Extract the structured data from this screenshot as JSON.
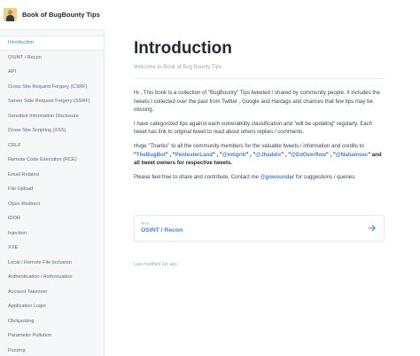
{
  "site": {
    "title": "Book of BugBounty Tips"
  },
  "sidebar": {
    "items": [
      {
        "label": "Introduction",
        "active": true
      },
      {
        "label": "OSINT / Recon"
      },
      {
        "label": "API"
      },
      {
        "label": "Cross Site Request Forgery (CSRF)"
      },
      {
        "label": "Server Side Request Forgery (SSRF)"
      },
      {
        "label": "Sensitive Information Disclosure"
      },
      {
        "label": "Cross Site Scripting (XSS)"
      },
      {
        "label": "CRLF"
      },
      {
        "label": "Remote Code Execution (RCE)"
      },
      {
        "label": "Email Related"
      },
      {
        "label": "File Upload"
      },
      {
        "label": "Open Redirect"
      },
      {
        "label": "IDOR"
      },
      {
        "label": "Injection"
      },
      {
        "label": "XXE"
      },
      {
        "label": "Local / Remote File Inclusion"
      },
      {
        "label": "Authentication / Authorization"
      },
      {
        "label": "Account Takeover"
      },
      {
        "label": "Application Login"
      },
      {
        "label": "Clickjacking"
      },
      {
        "label": "Parameter Pollution"
      },
      {
        "label": "Fuzzing"
      }
    ]
  },
  "page": {
    "title": "Introduction",
    "description": "Welcome to Book of Bug Bounty Tips",
    "paragraphs": {
      "p1": "Hi , This book is a collection of \"BugBounty\" Tips tweeted / shared by community people. It includes the tweets I collected over the past from Twitter , Google and Hastags and chances that few tips may be missing.",
      "p2": "I have categorized tips against each vulnerability classification and \"will be updating\" regularly. Each tweet has link to original tweet to read about others replies / comments.",
      "p3": {
        "intro": "Huge \"Thanks\" to all the community members for the valuable tweets / information and credits to ",
        "q_open": "\"",
        "sep1": "\" , \"",
        "sep2": "\" , \"",
        "sep3": "\" , \"",
        "sep4": "\" , \"",
        "sep5": "\" , \"",
        "q_close": "\"",
        "outro": " and all tweet owners for respective tweets.",
        "mentions": [
          "TheBugBot",
          "PentesterLand",
          "@intigriti",
          "@Jhaddix",
          "@EdOverflow",
          "@Nahamsec"
        ]
      },
      "p4": {
        "before": "Please feel free to share and contribute. Contact me ",
        "mention": "@gowsundar",
        "after": " for suggestions / queries."
      }
    },
    "next": {
      "caption": "Next",
      "label": "OSINT / Recon"
    },
    "last_modified": "Last modified 2yr ago"
  },
  "colors": {
    "accent": "#3884ff",
    "sidebar_bg": "#f5f7f9",
    "border": "#e6ecf1",
    "muted": "#9daab6"
  },
  "icons": {
    "next": "arrow-right-icon"
  }
}
